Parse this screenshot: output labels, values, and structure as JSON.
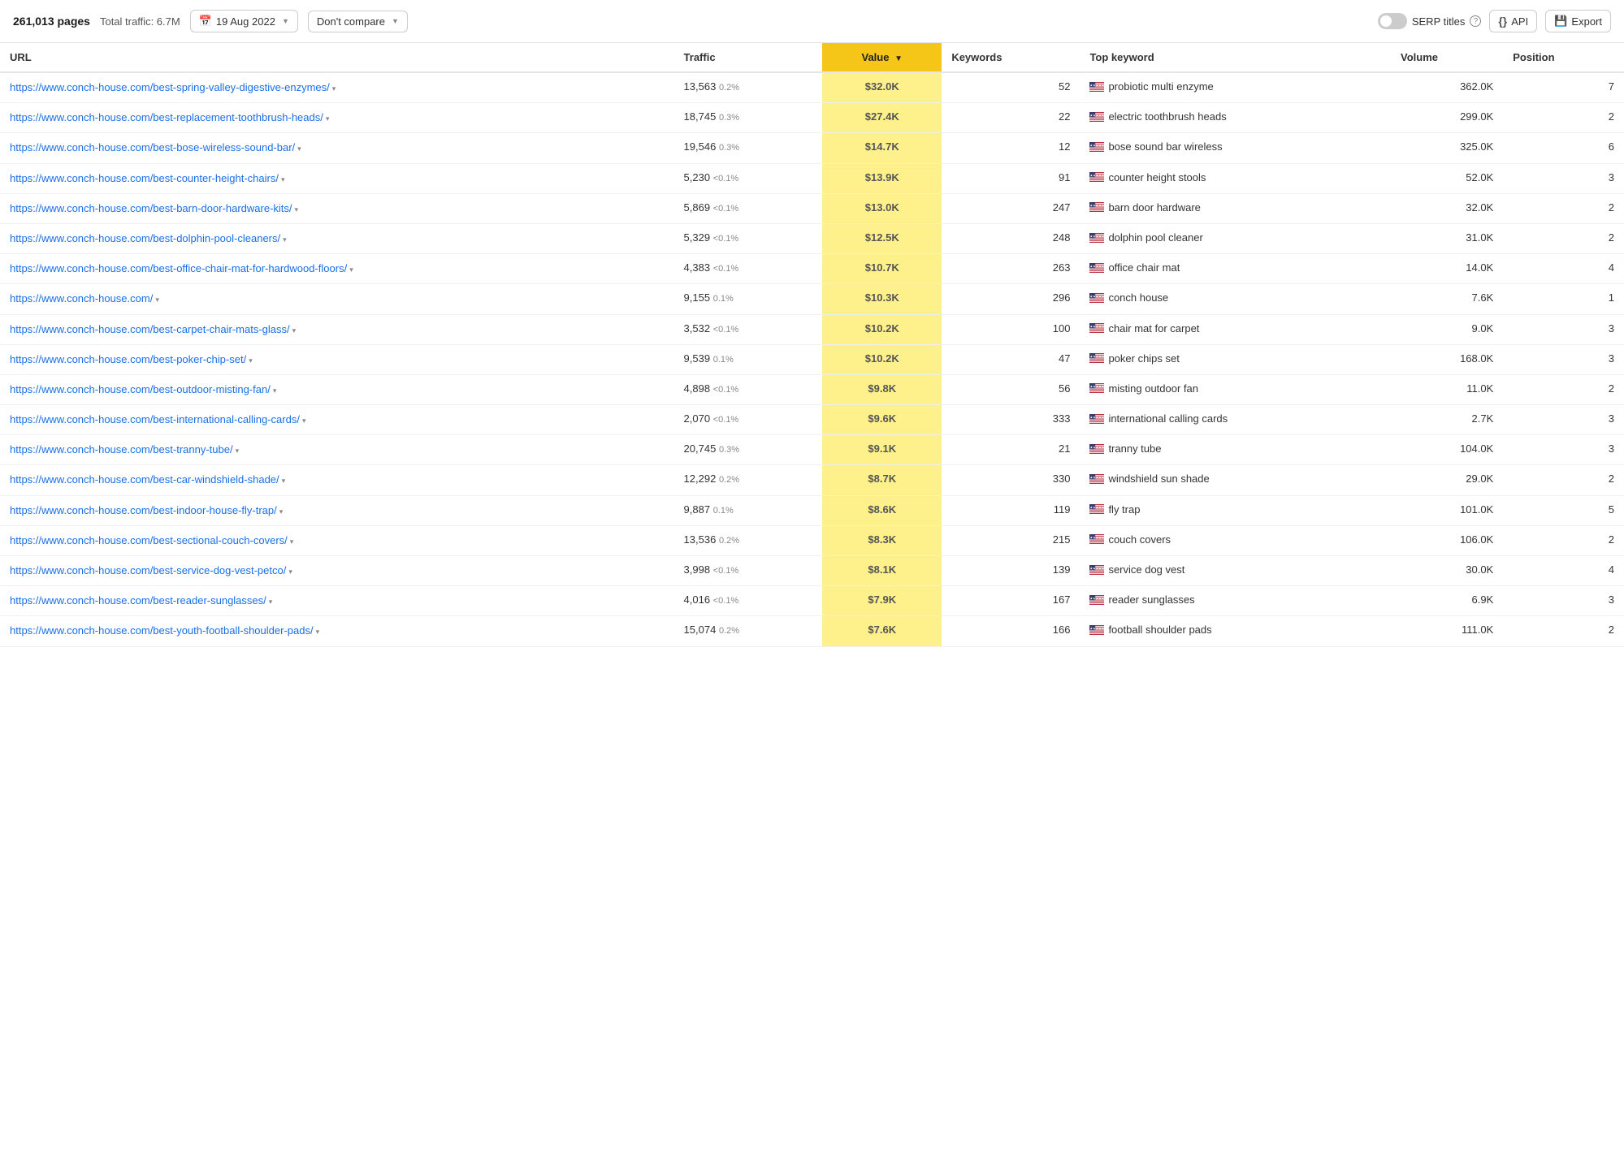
{
  "toolbar": {
    "pages_count": "261,013 pages",
    "total_traffic": "Total traffic: 6.7M",
    "date": "19 Aug 2022",
    "compare_label": "Don't compare",
    "serp_titles": "SERP titles",
    "api_label": "API",
    "export_label": "Export"
  },
  "table": {
    "headers": {
      "url": "URL",
      "traffic": "Traffic",
      "value": "Value",
      "keywords": "Keywords",
      "top_keyword": "Top keyword",
      "volume": "Volume",
      "position": "Position"
    },
    "rows": [
      {
        "url": "https://www.conch-house.com/best-spring-valley-digestive-enzymes/",
        "traffic": "13,563",
        "traffic_pct": "0.2%",
        "value": "$32.0K",
        "keywords": "52",
        "top_keyword": "probiotic multi enzyme",
        "volume": "362.0K",
        "position": "7"
      },
      {
        "url": "https://www.conch-house.com/best-replacement-toothbrush-heads/",
        "traffic": "18,745",
        "traffic_pct": "0.3%",
        "value": "$27.4K",
        "keywords": "22",
        "top_keyword": "electric toothbrush heads",
        "volume": "299.0K",
        "position": "2"
      },
      {
        "url": "https://www.conch-house.com/best-bose-wireless-sound-bar/",
        "traffic": "19,546",
        "traffic_pct": "0.3%",
        "value": "$14.7K",
        "keywords": "12",
        "top_keyword": "bose sound bar wireless",
        "volume": "325.0K",
        "position": "6"
      },
      {
        "url": "https://www.conch-house.com/best-counter-height-chairs/",
        "traffic": "5,230",
        "traffic_pct": "<0.1%",
        "value": "$13.9K",
        "keywords": "91",
        "top_keyword": "counter height stools",
        "volume": "52.0K",
        "position": "3"
      },
      {
        "url": "https://www.conch-house.com/best-barn-door-hardware-kits/",
        "traffic": "5,869",
        "traffic_pct": "<0.1%",
        "value": "$13.0K",
        "keywords": "247",
        "top_keyword": "barn door hardware",
        "volume": "32.0K",
        "position": "2"
      },
      {
        "url": "https://www.conch-house.com/best-dolphin-pool-cleaners/",
        "traffic": "5,329",
        "traffic_pct": "<0.1%",
        "value": "$12.5K",
        "keywords": "248",
        "top_keyword": "dolphin pool cleaner",
        "volume": "31.0K",
        "position": "2"
      },
      {
        "url": "https://www.conch-house.com/best-office-chair-mat-for-hardwood-floors/",
        "traffic": "4,383",
        "traffic_pct": "<0.1%",
        "value": "$10.7K",
        "keywords": "263",
        "top_keyword": "office chair mat",
        "volume": "14.0K",
        "position": "4"
      },
      {
        "url": "https://www.conch-house.com/",
        "traffic": "9,155",
        "traffic_pct": "0.1%",
        "value": "$10.3K",
        "keywords": "296",
        "top_keyword": "conch house",
        "volume": "7.6K",
        "position": "1"
      },
      {
        "url": "https://www.conch-house.com/best-carpet-chair-mats-glass/",
        "traffic": "3,532",
        "traffic_pct": "<0.1%",
        "value": "$10.2K",
        "keywords": "100",
        "top_keyword": "chair mat for carpet",
        "volume": "9.0K",
        "position": "3"
      },
      {
        "url": "https://www.conch-house.com/best-poker-chip-set/",
        "traffic": "9,539",
        "traffic_pct": "0.1%",
        "value": "$10.2K",
        "keywords": "47",
        "top_keyword": "poker chips set",
        "volume": "168.0K",
        "position": "3"
      },
      {
        "url": "https://www.conch-house.com/best-outdoor-misting-fan/",
        "traffic": "4,898",
        "traffic_pct": "<0.1%",
        "value": "$9.8K",
        "keywords": "56",
        "top_keyword": "misting outdoor fan",
        "volume": "11.0K",
        "position": "2"
      },
      {
        "url": "https://www.conch-house.com/best-international-calling-cards/",
        "traffic": "2,070",
        "traffic_pct": "<0.1%",
        "value": "$9.6K",
        "keywords": "333",
        "top_keyword": "international calling cards",
        "volume": "2.7K",
        "position": "3"
      },
      {
        "url": "https://www.conch-house.com/best-tranny-tube/",
        "traffic": "20,745",
        "traffic_pct": "0.3%",
        "value": "$9.1K",
        "keywords": "21",
        "top_keyword": "tranny tube",
        "volume": "104.0K",
        "position": "3"
      },
      {
        "url": "https://www.conch-house.com/best-car-windshield-shade/",
        "traffic": "12,292",
        "traffic_pct": "0.2%",
        "value": "$8.7K",
        "keywords": "330",
        "top_keyword": "windshield sun shade",
        "volume": "29.0K",
        "position": "2"
      },
      {
        "url": "https://www.conch-house.com/best-indoor-house-fly-trap/",
        "traffic": "9,887",
        "traffic_pct": "0.1%",
        "value": "$8.6K",
        "keywords": "119",
        "top_keyword": "fly trap",
        "volume": "101.0K",
        "position": "5"
      },
      {
        "url": "https://www.conch-house.com/best-sectional-couch-covers/",
        "traffic": "13,536",
        "traffic_pct": "0.2%",
        "value": "$8.3K",
        "keywords": "215",
        "top_keyword": "couch covers",
        "volume": "106.0K",
        "position": "2"
      },
      {
        "url": "https://www.conch-house.com/best-service-dog-vest-petco/",
        "traffic": "3,998",
        "traffic_pct": "<0.1%",
        "value": "$8.1K",
        "keywords": "139",
        "top_keyword": "service dog vest",
        "volume": "30.0K",
        "position": "4"
      },
      {
        "url": "https://www.conch-house.com/best-reader-sunglasses/",
        "traffic": "4,016",
        "traffic_pct": "<0.1%",
        "value": "$7.9K",
        "keywords": "167",
        "top_keyword": "reader sunglasses",
        "volume": "6.9K",
        "position": "3"
      },
      {
        "url": "https://www.conch-house.com/best-youth-football-shoulder-pads/",
        "traffic": "15,074",
        "traffic_pct": "0.2%",
        "value": "$7.6K",
        "keywords": "166",
        "top_keyword": "football shoulder pads",
        "volume": "111.0K",
        "position": "2"
      }
    ]
  }
}
